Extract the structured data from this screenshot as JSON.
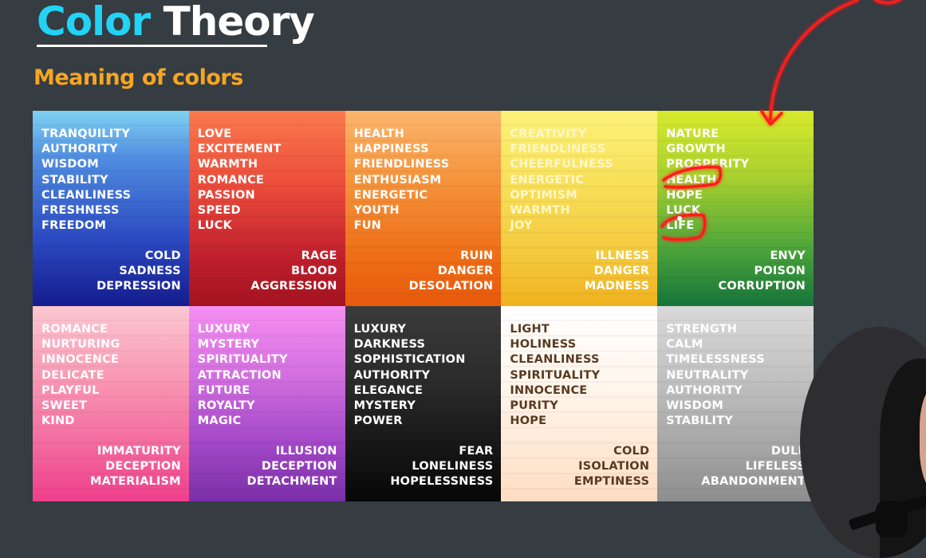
{
  "header": {
    "title_part1": "Color",
    "title_part2": "Theory",
    "subtitle": "Meaning of colors"
  },
  "colors": {
    "title_accent": "#22d3f5",
    "subtitle": "#f5a623",
    "background": "#353c42",
    "annotation": "#ff2020"
  },
  "cells": [
    {
      "color": "blue",
      "positive": [
        "TRANQUILITY",
        "AUTHORITY",
        "WISDOM",
        "STABILITY",
        "CLEANLINESS",
        "FRESHNESS",
        "FREEDOM"
      ],
      "negative": [
        "COLD",
        "SADNESS",
        "DEPRESSION"
      ]
    },
    {
      "color": "red",
      "positive": [
        "LOVE",
        "EXCITEMENT",
        "WARMTH",
        "ROMANCE",
        "PASSION",
        "SPEED",
        "LUCK"
      ],
      "negative": [
        "RAGE",
        "BLOOD",
        "AGGRESSION"
      ]
    },
    {
      "color": "orange",
      "positive": [
        "HEALTH",
        "HAPPINESS",
        "FRIENDLINESS",
        "ENTHUSIASM",
        "ENERGETIC",
        "YOUTH",
        "FUN"
      ],
      "negative": [
        "RUIN",
        "DANGER",
        "DESOLATION"
      ]
    },
    {
      "color": "yellow",
      "positive": [
        "CREATIVITY",
        "FRIENDLINESS",
        "CHEERFULNESS",
        "ENERGETIC",
        "OPTIMISM",
        "WARMTH",
        "JOY"
      ],
      "negative": [
        "ILLNESS",
        "DANGER",
        "MADNESS"
      ]
    },
    {
      "color": "green",
      "positive": [
        "NATURE",
        "GROWTH",
        "PROSPERITY",
        "HEALTH",
        "HOPE",
        "LUCK",
        "LIFE"
      ],
      "negative": [
        "ENVY",
        "POISON",
        "CORRUPTION"
      ]
    },
    {
      "color": "pink",
      "positive": [
        "ROMANCE",
        "NURTURING",
        "INNOCENCE",
        "DELICATE",
        "PLAYFUL",
        "SWEET",
        "KIND"
      ],
      "negative": [
        "IMMATURITY",
        "DECEPTION",
        "MATERIALISM"
      ]
    },
    {
      "color": "purple",
      "positive": [
        "LUXURY",
        "MYSTERY",
        "SPIRITUALITY",
        "ATTRACTION",
        "FUTURE",
        "ROYALTY",
        "MAGIC"
      ],
      "negative": [
        "ILLUSION",
        "DECEPTION",
        "DETACHMENT"
      ]
    },
    {
      "color": "black",
      "positive": [
        "LUXURY",
        "DARKNESS",
        "SOPHISTICATION",
        "AUTHORITY",
        "ELEGANCE",
        "MYSTERY",
        "POWER"
      ],
      "negative": [
        "FEAR",
        "LONELINESS",
        "HOPELESSNESS"
      ]
    },
    {
      "color": "white",
      "positive": [
        "LIGHT",
        "HOLINESS",
        "CLEANLINESS",
        "SPIRITUALITY",
        "INNOCENCE",
        "PURITY",
        "HOPE"
      ],
      "negative": [
        "COLD",
        "ISOLATION",
        "EMPTINESS"
      ]
    },
    {
      "color": "grey",
      "positive": [
        "STRENGTH",
        "CALM",
        "TIMELESSNESS",
        "NEUTRALITY",
        "AUTHORITY",
        "WISDOM",
        "STABILITY"
      ],
      "negative": [
        "DULL",
        "LIFELESS",
        "ABANDONMENT"
      ]
    }
  ]
}
